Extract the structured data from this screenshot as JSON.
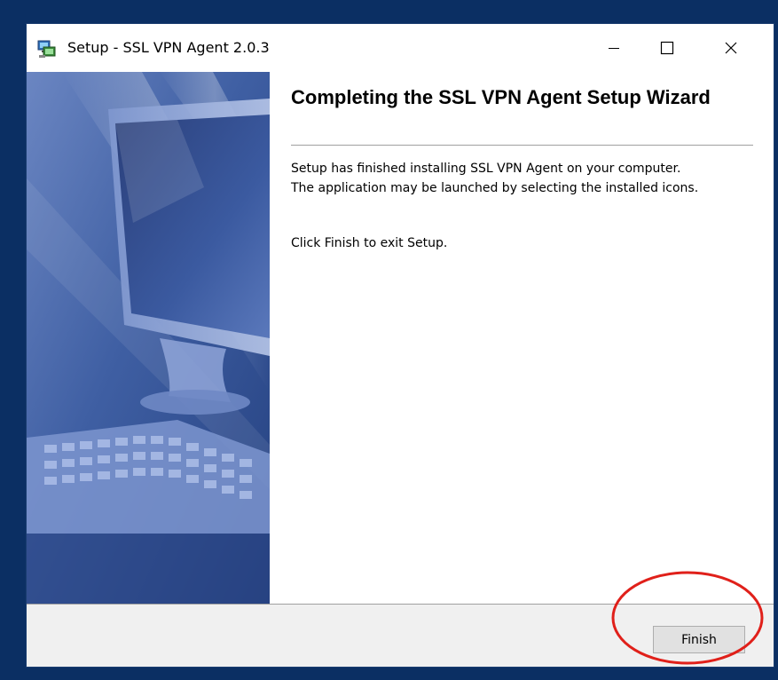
{
  "window": {
    "title": "Setup - SSL VPN Agent 2.0.3",
    "icon": "setup-computer-icon",
    "controls": {
      "minimize": "minimize-icon",
      "maximize": "maximize-icon",
      "close": "close-icon"
    }
  },
  "sidebar": {
    "image": "computer-monitor-keyboard-illustration"
  },
  "content": {
    "heading": "Completing the SSL VPN Agent Setup Wizard",
    "line1": "Setup has finished installing SSL VPN Agent on your computer.",
    "line2": "The application may be launched by selecting the installed icons.",
    "line3": "Click Finish to exit Setup."
  },
  "footer": {
    "finish_label": "Finish"
  },
  "colors": {
    "desktop": "#0b2f63",
    "highlight_circle": "#e0201a",
    "sidebar_blue": "#3f5fa3"
  }
}
